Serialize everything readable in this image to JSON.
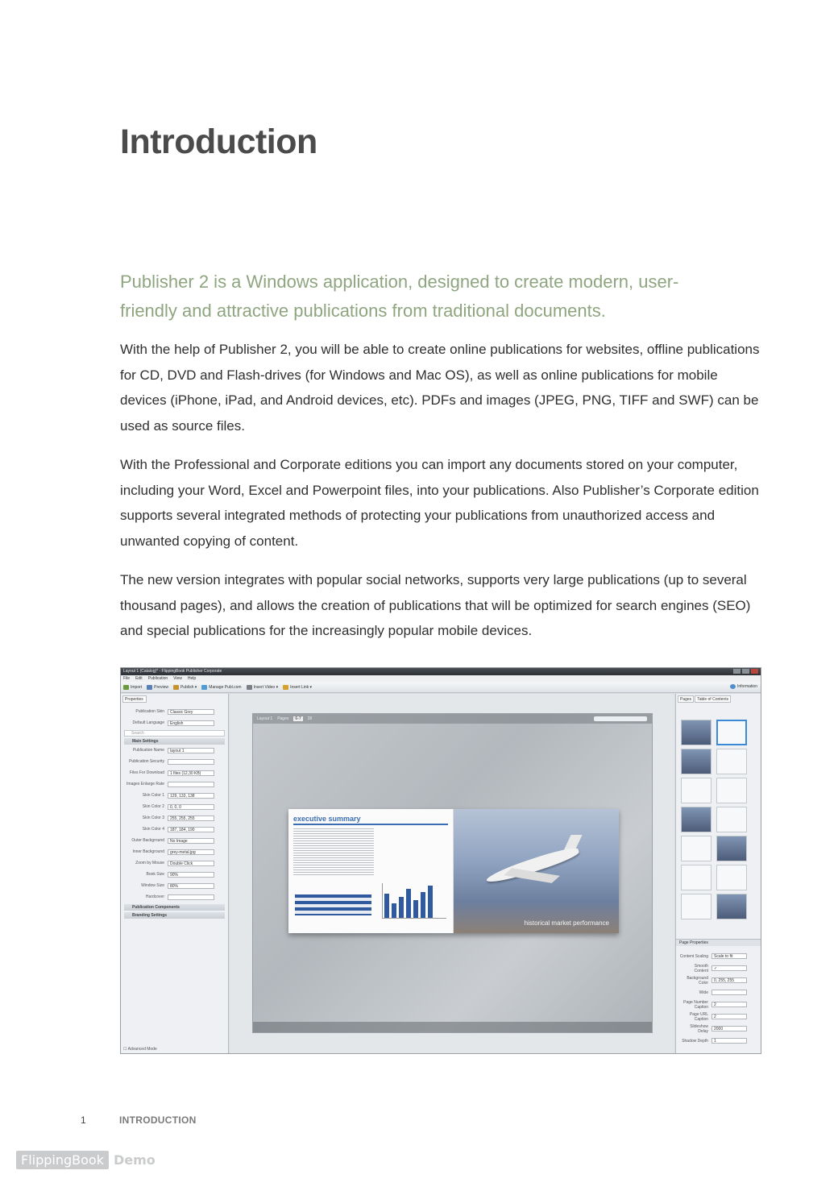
{
  "page": {
    "title": "Introduction",
    "lead": "Publisher 2 is a Windows application, designed to create modern, user-friendly and attractive publications from traditional documents.",
    "paragraphs": [
      "With the help of Publisher 2, you will be able to create online publications for websites, offline publications for CD, DVD and Flash-drives (for Windows and Mac OS), as well as online publications for mobile devices (iPhone, iPad, and Android devices, etc). PDFs and images (JPEG, PNG, TIFF and SWF) can be used as source files.",
      "With the Professional and Corporate editions you can import any documents stored on your computer, including your Word, Excel and Powerpoint files, into your publications. Also Publisher’s Corporate edition supports several integrated methods of protecting your publications from unauthorized access and unwanted copying of content.",
      "The new version integrates with popular social networks, supports very large publications (up to several thousand pages), and allows the creation of publications that will be optimized for search engines (SEO) and special publications for the increasingly popular mobile devices."
    ]
  },
  "app": {
    "window_title": "Layout 1 (Catalog)* - FlippingBook Publisher Corporate",
    "menu": [
      "File",
      "Edit",
      "Publication",
      "View",
      "Help"
    ],
    "toolbar": [
      "Import",
      "Preview",
      "Publish ▾",
      "Manage Publ.com",
      "Insert Video ▾",
      "Insert Link ▾"
    ],
    "toolbar_info": "Information",
    "left_tab": "Properties",
    "top_props": [
      {
        "label": "Publication Skin",
        "value": "Classic Grey"
      },
      {
        "label": "Default Language",
        "value": "English"
      }
    ],
    "search_placeholder": "Search",
    "main_section": "Main Settings",
    "main_props": [
      {
        "label": "Publication Name",
        "value": "layout 1"
      },
      {
        "label": "Publication Security",
        "value": ""
      },
      {
        "label": "Files For Download",
        "value": "1 files (12,30 KB)"
      },
      {
        "label": "Images Enlarge Rate",
        "value": ""
      },
      {
        "label": "Skin Color 1",
        "value": "129, 133, 138"
      },
      {
        "label": "Skin Color 2",
        "value": "0, 0, 0"
      },
      {
        "label": "Skin Color 3",
        "value": "255, 255, 255"
      },
      {
        "label": "Skin Color 4",
        "value": "187, 184, 190"
      },
      {
        "label": "Outer Background",
        "value": "No Image"
      },
      {
        "label": "Inner Background",
        "value": "grey-metal.jpg"
      },
      {
        "label": "Zoom by Mouse",
        "value": "Double Click"
      },
      {
        "label": "Book Size",
        "value": "90%"
      },
      {
        "label": "Window Size",
        "value": "80%"
      },
      {
        "label": "Hardcover",
        "value": ""
      }
    ],
    "sections": [
      "Publication Components",
      "Branding Settings"
    ],
    "advanced_mode": "Advanced Mode",
    "stage_top": [
      "Layout 1",
      "Pages",
      "6-7",
      "28"
    ],
    "book_title": "executive summary",
    "book_caption": "historical market performance",
    "right_tabs": [
      "Pages",
      "Table of Contents"
    ],
    "page_props_header": "Page Properties",
    "page_props": [
      {
        "label": "Content Scaling",
        "value": "Scale to fit"
      },
      {
        "label": "Smooth Content",
        "value": "✓"
      },
      {
        "label": "Background Color",
        "value": "0, 255, 255"
      },
      {
        "label": "Wide",
        "value": ""
      },
      {
        "label": "Page Number Caption",
        "value": "2"
      },
      {
        "label": "Page URL Caption",
        "value": "2"
      },
      {
        "label": "Slideshow Delay",
        "value": "2000"
      },
      {
        "label": "Shadow Depth",
        "value": "1"
      }
    ],
    "colors": {
      "accent_blue": "#3b6db3",
      "chart_blue": "#2f5aa0"
    }
  },
  "footer": {
    "page_number": "1",
    "section": "INTRODUCTION"
  },
  "watermark": {
    "brand": "FlippingBook",
    "label": "Demo"
  }
}
